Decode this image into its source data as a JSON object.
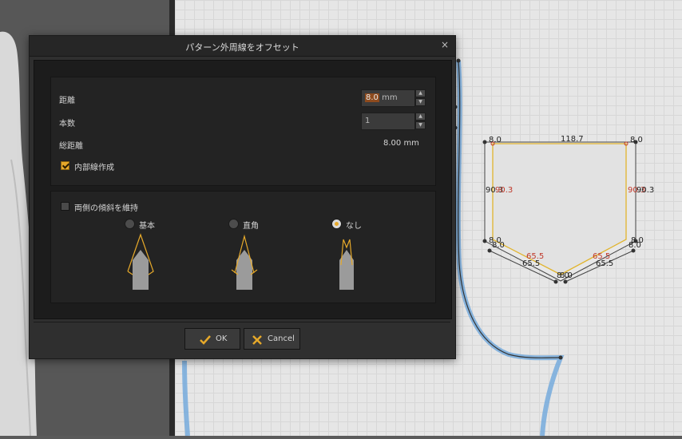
{
  "dialog": {
    "title": "パターン外周線をオフセット",
    "close_glyph": "×",
    "distance": {
      "label": "距離",
      "value": "8.0",
      "unit": "mm"
    },
    "count": {
      "label": "本数",
      "value": "1"
    },
    "total_distance": {
      "label": "総距離",
      "value": "8.00 mm"
    },
    "create_inner_line": {
      "label": "内部線作成",
      "checked": true
    },
    "keep_both_slopes": {
      "label": "両側の傾斜を維持",
      "checked": false
    },
    "angle_options": [
      {
        "label": "基本",
        "selected": false
      },
      {
        "label": "直角",
        "selected": false
      },
      {
        "label": "なし",
        "selected": true
      }
    ],
    "ok_label": "OK",
    "cancel_label": "Cancel",
    "spin_up_glyph": "▲",
    "spin_down_glyph": "▼"
  },
  "pattern_labels": [
    "8.0",
    "118.7",
    "8.0",
    "90.3",
    "90.3",
    "90.3",
    "90.3",
    "8.0",
    "8.0",
    "8.0",
    "8.0",
    "65.5",
    "65.5",
    "65.5",
    "65.5",
    "8.0",
    "8.0"
  ],
  "colors": {
    "accent": "#e6a92a",
    "pattern_edge_highlight": "#e1b42c",
    "pattern_outline_blue": "#6fa8dc",
    "measure_red": "#c0392b"
  }
}
